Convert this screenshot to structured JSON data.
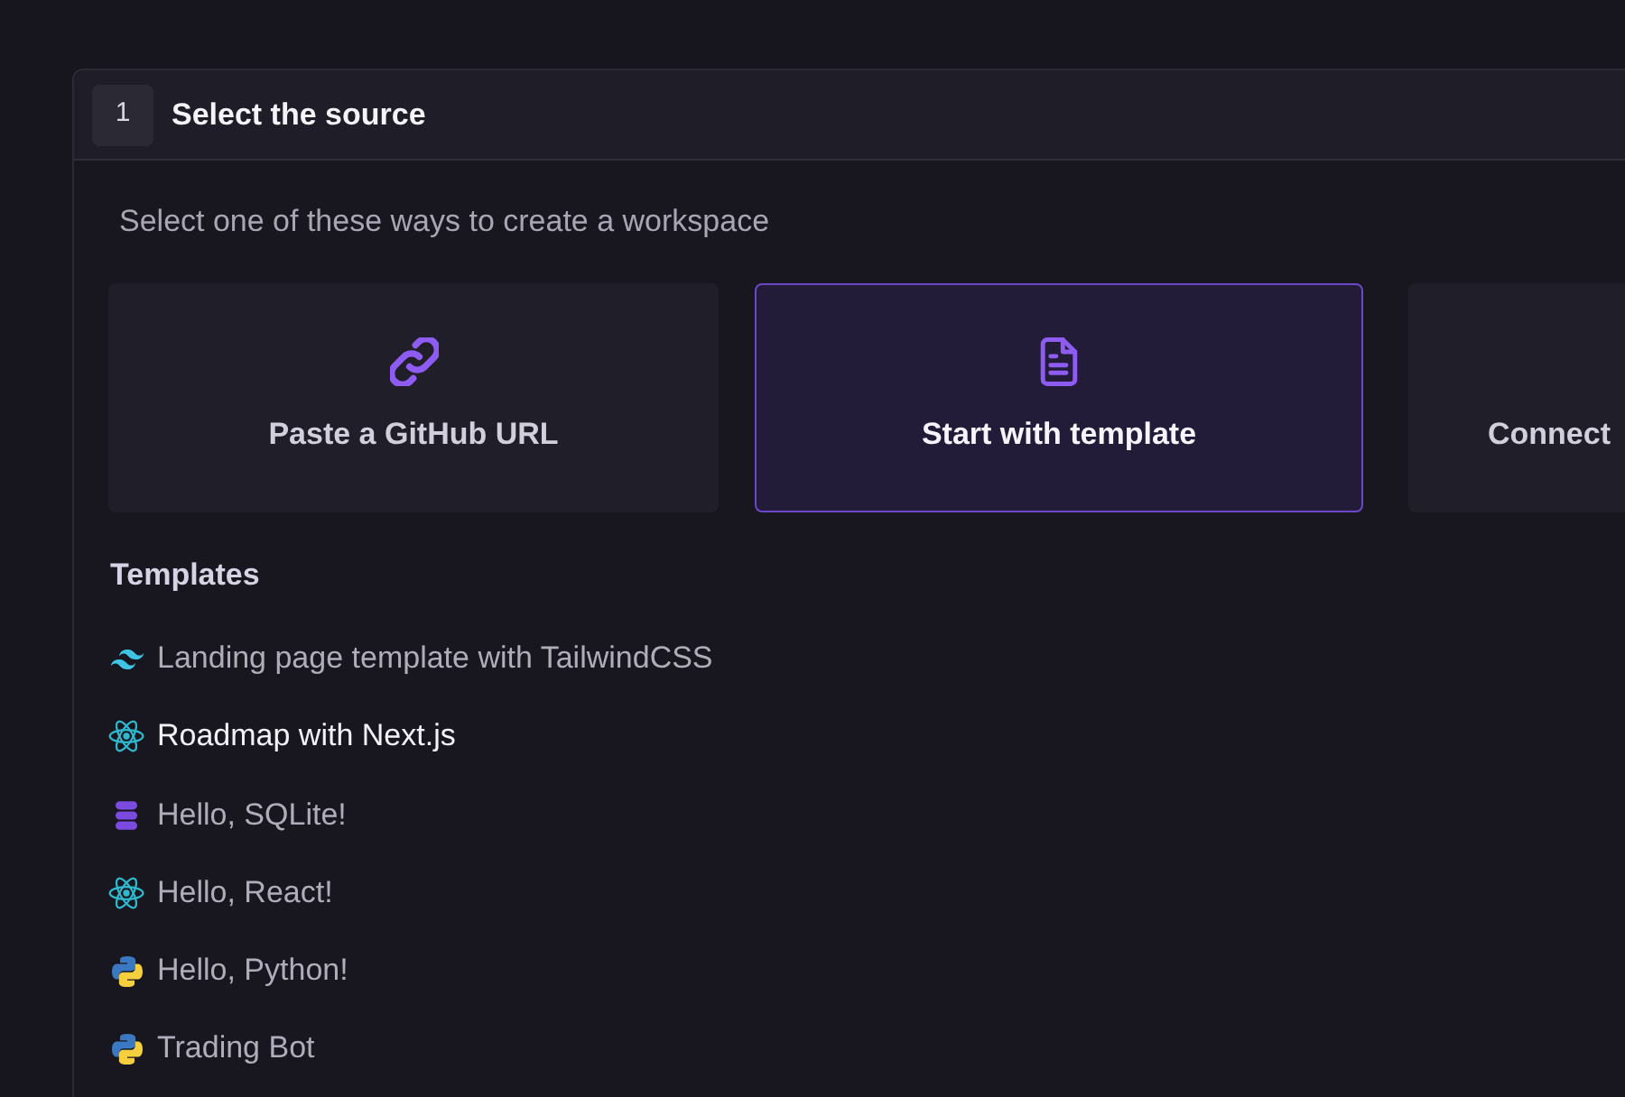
{
  "step": {
    "number": "1",
    "title": "Select the source"
  },
  "subtitle": "Select one of these ways to create a workspace",
  "cards": [
    {
      "label": "Paste a GitHub URL",
      "kind": "link",
      "selected": false
    },
    {
      "label": "Start with template",
      "kind": "document",
      "selected": true
    },
    {
      "label": "Connect",
      "selected": false
    }
  ],
  "templates": {
    "heading": "Templates",
    "items": [
      {
        "label": "Landing page template with TailwindCSS",
        "kind": "wave",
        "selected": false
      },
      {
        "label": "Roadmap with Next.js",
        "kind": "atom",
        "selected": true
      },
      {
        "label": "Hello, SQLite!",
        "kind": "database",
        "selected": false
      },
      {
        "label": "Hello, React!",
        "kind": "atom",
        "selected": false
      },
      {
        "label": "Hello, Python!",
        "kind": "snakes",
        "selected": false
      },
      {
        "label": "Trading Bot",
        "kind": "snakes",
        "selected": false
      }
    ]
  }
}
